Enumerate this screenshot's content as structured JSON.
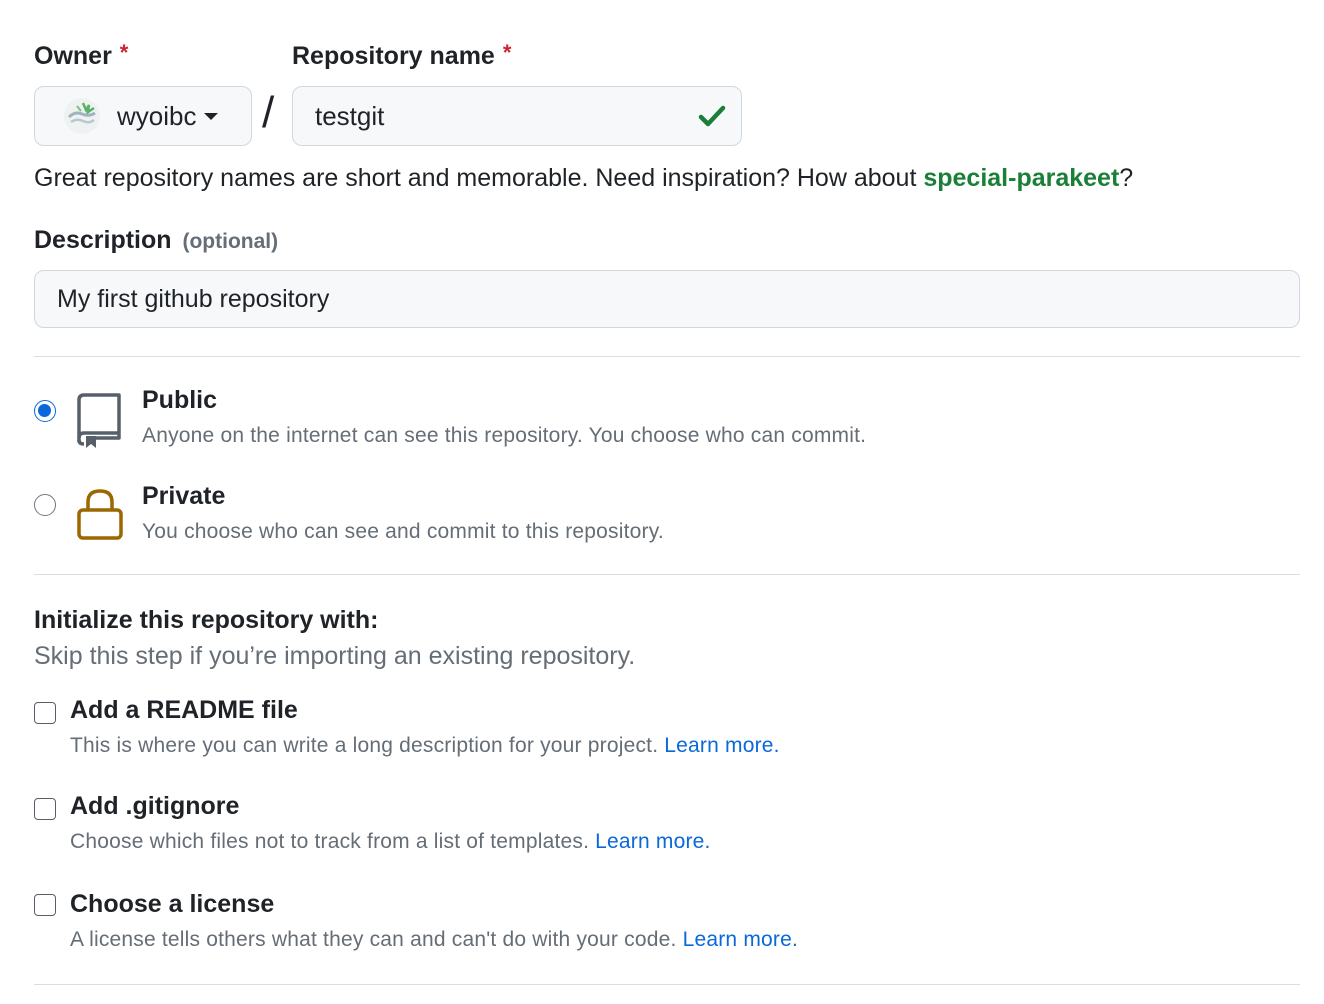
{
  "owner": {
    "label": "Owner",
    "required_mark": "*",
    "selected": "wyoibc"
  },
  "repo": {
    "label": "Repository name",
    "required_mark": "*",
    "value": "testgit",
    "separator": "/"
  },
  "hint": {
    "prefix": "Great repository names are short and memorable. Need inspiration? How about ",
    "suggestion": "special-parakeet",
    "suffix": "?"
  },
  "description": {
    "label": "Description",
    "optional": "(optional)",
    "value": "My first github repository"
  },
  "visibility": {
    "selected": "public",
    "options": [
      {
        "id": "public",
        "title": "Public",
        "desc": "Anyone on the internet can see this repository. You choose who can commit.",
        "icon": "repo-icon"
      },
      {
        "id": "private",
        "title": "Private",
        "desc": "You choose who can see and commit to this repository.",
        "icon": "lock-icon"
      }
    ]
  },
  "init": {
    "title": "Initialize this repository with:",
    "subtitle": "Skip this step if you’re importing an existing repository.",
    "items": [
      {
        "title": "Add a README file",
        "desc": "This is where you can write a long description for your project.",
        "link": "Learn more.",
        "checked": false
      },
      {
        "title": "Add .gitignore",
        "desc": "Choose which files not to track from a list of templates.",
        "link": "Learn more.",
        "checked": false
      },
      {
        "title": "Choose a license",
        "desc": "A license tells others what they can and can't do with your code.",
        "link": "Learn more.",
        "checked": false
      }
    ]
  },
  "colors": {
    "accent": "#0969da",
    "success": "#1a7f37",
    "danger": "#cf222e",
    "lock": "#9a6700"
  }
}
